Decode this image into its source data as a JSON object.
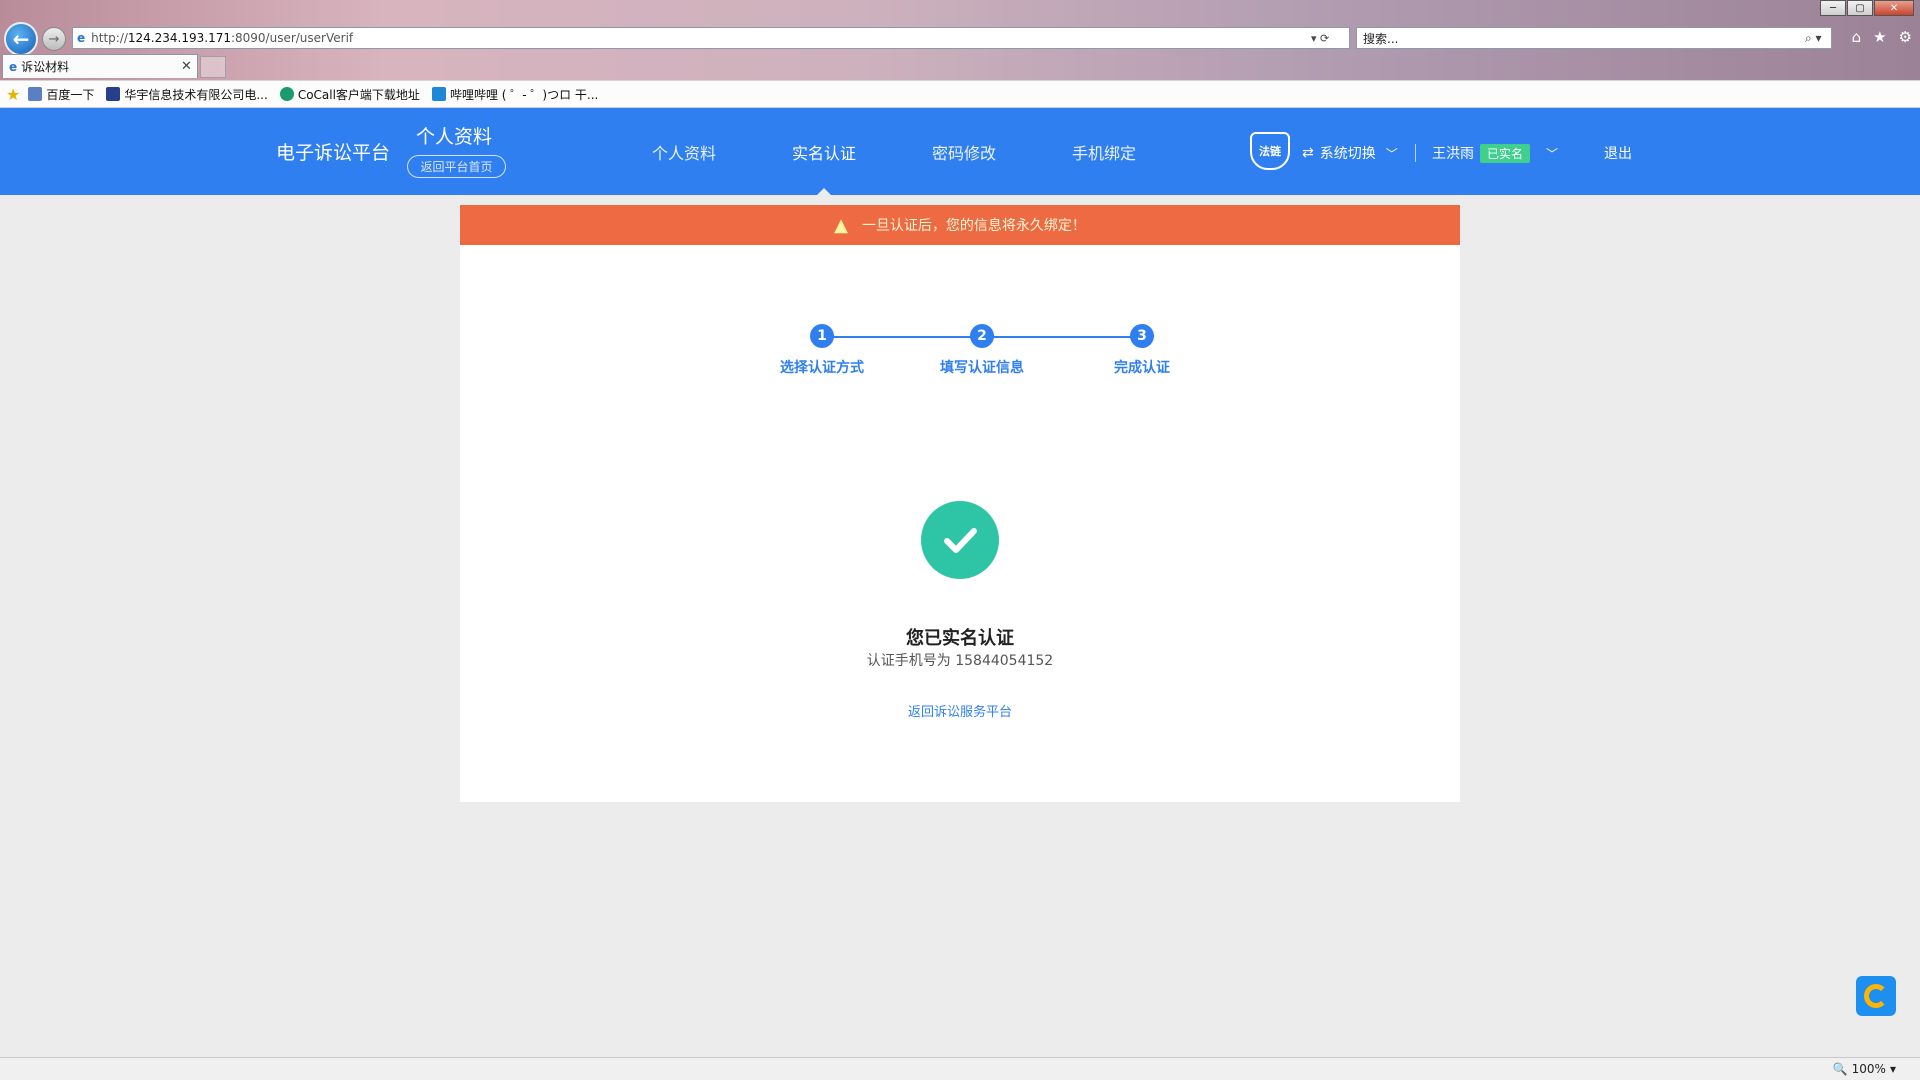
{
  "browser": {
    "url_prefix": "http://",
    "url_host": "124.234.193.171",
    "url_rest": ":8090/user/userVerif",
    "search_placeholder": "搜索...",
    "tab_title": "诉讼材料",
    "zoom": "100%",
    "favorites": [
      {
        "label": "百度一下",
        "icon": "page-icon"
      },
      {
        "label": "华宇信息技术有限公司电...",
        "icon": "thunisoft-icon"
      },
      {
        "label": "CoCall客户端下载地址",
        "icon": "cocall-icon"
      },
      {
        "label": "哔哩哔哩 ( ゜- ゜)つロ 干...",
        "icon": "bilibili-icon"
      }
    ]
  },
  "header": {
    "brand": "电子诉讼平台",
    "section_title": "个人资料",
    "home_button": "返回平台首页",
    "nav": [
      "个人资料",
      "实名认证",
      "密码修改",
      "手机绑定"
    ],
    "active_nav": "实名认证",
    "shield_label": "法链",
    "system_switch": "系统切换",
    "user_name": "王洪雨",
    "verified_badge": "已实名",
    "logout": "退出",
    "brand_color": "#2f7ff0"
  },
  "alert": {
    "text": "一旦认证后，您的信息将永久绑定！",
    "color": "#ee6a43"
  },
  "steps": [
    {
      "num": "1",
      "label": "选择认证方式"
    },
    {
      "num": "2",
      "label": "填写认证信息"
    },
    {
      "num": "3",
      "label": "完成认证"
    }
  ],
  "result": {
    "title": "您已实名认证",
    "subtitle": "认证手机号为 15844054152",
    "link": "返回诉讼服务平台",
    "check_color": "#2ec4a6"
  }
}
